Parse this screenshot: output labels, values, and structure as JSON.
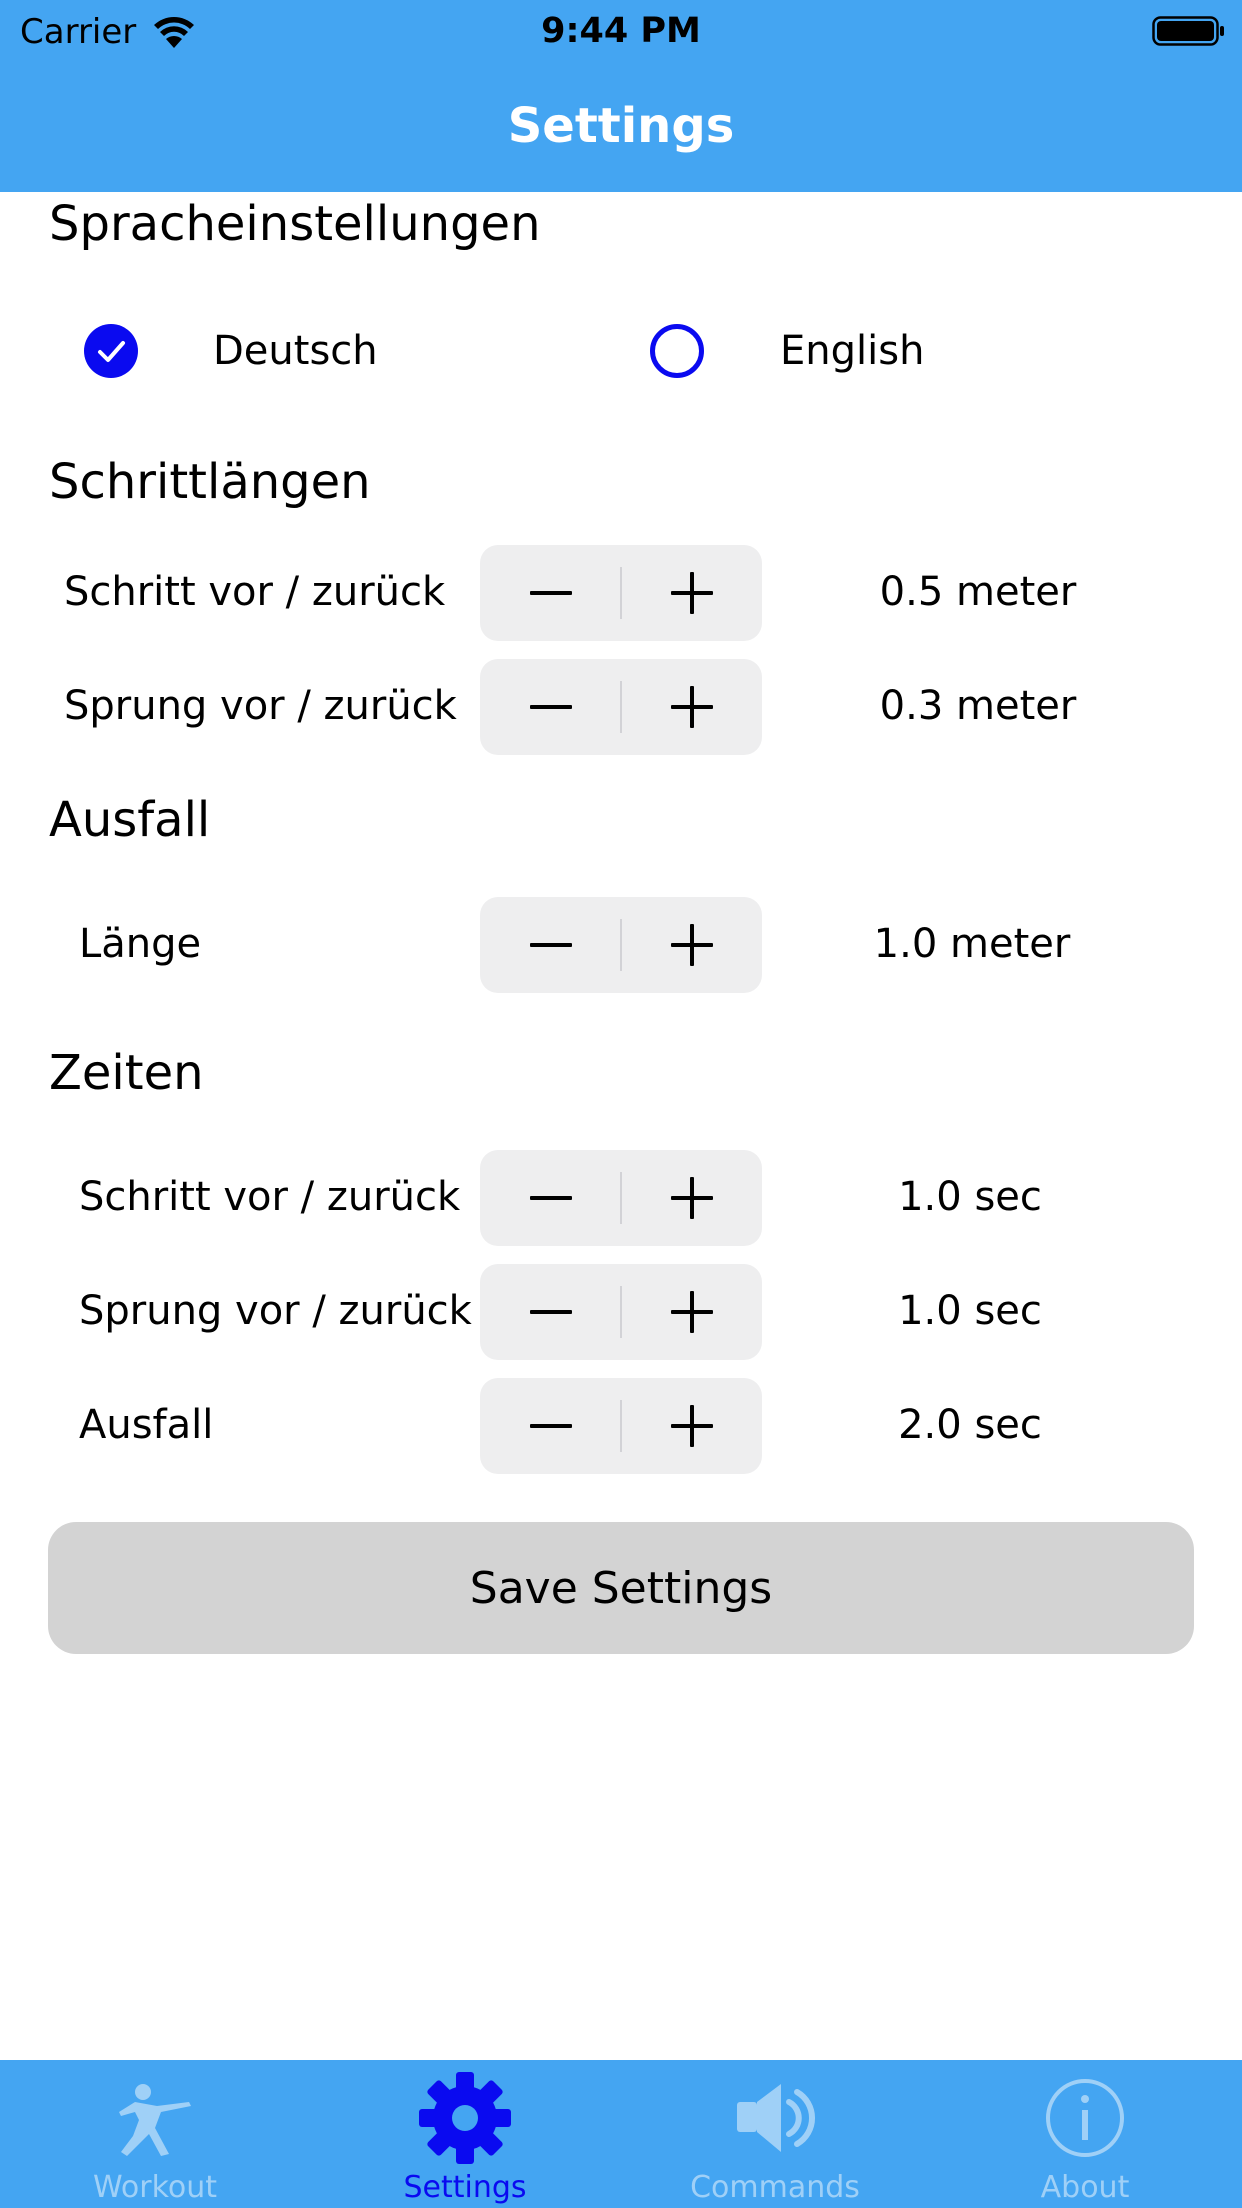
{
  "status_bar": {
    "carrier": "Carrier",
    "time": "9:44 PM"
  },
  "nav": {
    "title": "Settings"
  },
  "language": {
    "title": "Spracheinstellungen",
    "options": [
      {
        "label": "Deutsch",
        "selected": true
      },
      {
        "label": "English",
        "selected": false
      }
    ]
  },
  "step_lengths": {
    "title": "Schrittlängen",
    "rows": [
      {
        "label": "Schritt vor / zurück",
        "value": "0.5 meter"
      },
      {
        "label": "Sprung vor / zurück",
        "value": "0.3 meter"
      }
    ]
  },
  "lunge": {
    "title": "Ausfall",
    "rows": [
      {
        "label": "Länge",
        "value": "1.0 meter"
      }
    ]
  },
  "times": {
    "title": "Zeiten",
    "rows": [
      {
        "label": "Schritt vor / zurück",
        "value": "1.0 sec"
      },
      {
        "label": "Sprung vor / zurück",
        "value": "1.0 sec"
      },
      {
        "label": "Ausfall",
        "value": "2.0 sec"
      }
    ]
  },
  "save_button": {
    "label": "Save Settings"
  },
  "tabbar": {
    "tabs": [
      {
        "label": "Workout",
        "icon": "fencer-icon",
        "active": false
      },
      {
        "label": "Settings",
        "icon": "gear-icon",
        "active": true
      },
      {
        "label": "Commands",
        "icon": "speaker-icon",
        "active": false
      },
      {
        "label": "About",
        "icon": "info-icon",
        "active": false
      }
    ]
  },
  "colors": {
    "header": "#44a5f2",
    "accent": "#0a0af0",
    "inactive_tab": "#9fd0f7",
    "stepper_bg": "#eeeeef",
    "button_bg": "#d3d3d3"
  }
}
